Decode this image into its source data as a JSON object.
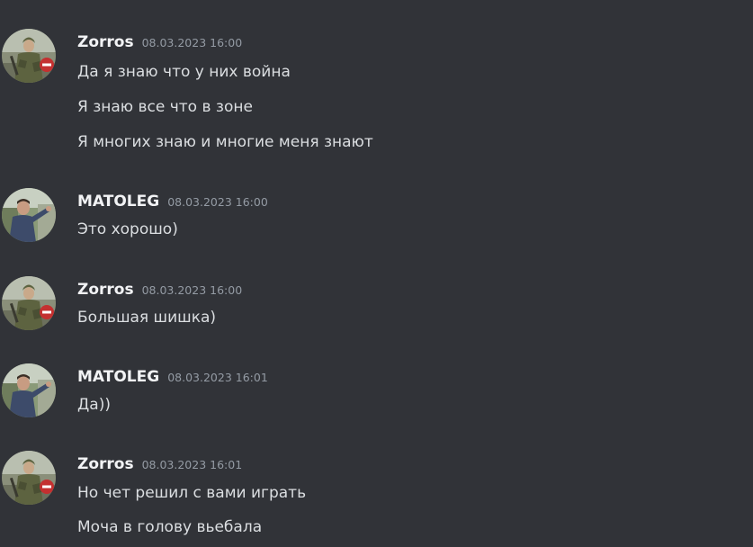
{
  "messages": [
    {
      "author": "Zorros",
      "timestamp": "08.03.2023 16:00",
      "avatar_icon": "soldier-avatar-icon",
      "lines": [
        "Да я знаю что у них война",
        "Я знаю все что в зоне",
        "Я многих знаю и многие меня знают"
      ]
    },
    {
      "author": "MATOLEG",
      "timestamp": "08.03.2023 16:00",
      "avatar_icon": "person-avatar-icon",
      "lines": [
        "Это хорошо)"
      ]
    },
    {
      "author": "Zorros",
      "timestamp": "08.03.2023 16:00",
      "avatar_icon": "soldier-avatar-icon",
      "lines": [
        "Большая шишка)"
      ]
    },
    {
      "author": "MATOLEG",
      "timestamp": "08.03.2023 16:01",
      "avatar_icon": "person-avatar-icon",
      "lines": [
        "Да))"
      ]
    },
    {
      "author": "Zorros",
      "timestamp": "08.03.2023 16:01",
      "avatar_icon": "soldier-avatar-icon",
      "lines": [
        "Но чет решил с вами играть",
        "Моча в голову вьебала"
      ]
    }
  ],
  "colors": {
    "background": "#313338",
    "username": "#f2f3f5",
    "timestamp": "#949ba4",
    "message_text": "#dbdee1"
  }
}
